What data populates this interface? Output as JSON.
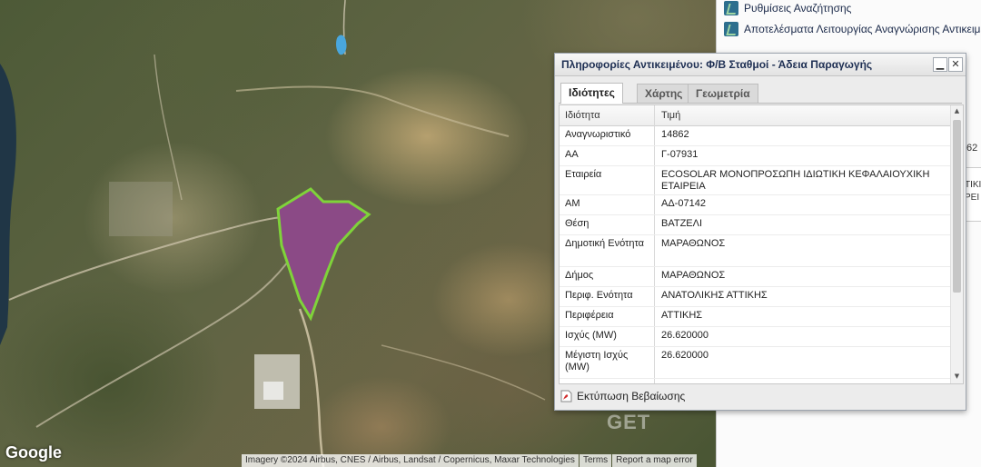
{
  "map": {
    "logo": "Google",
    "attribution": [
      "Imagery ©2024 Airbus, CNES / Airbus, Landsat / Copernicus, Maxar Technologies",
      "Terms",
      "Report a map error"
    ],
    "watermark": "GET",
    "parcel_color": "#8b4a86",
    "parcel_outline": "#7fd33a"
  },
  "side_panel": {
    "items": [
      {
        "label": "Ρυθμίσεις Αναζήτησης",
        "icon": "search-settings-icon"
      },
      {
        "label": "Αποτελέσματα Λειτουργίας Αναγνώρισης Αντικειμένων",
        "icon": "identify-results-icon"
      }
    ],
    "fragments": [
      "62",
      "ΤΙΚΙ",
      "ΡΕΙ"
    ]
  },
  "window": {
    "title": "Πληροφορίες Αντικειμένου: Φ/Β Σταθμοί - Άδεια Παραγωγής",
    "minimize": "▁",
    "close": "✕",
    "tabs": [
      "Ιδιότητες",
      "Χάρτης",
      "Γεωμετρία"
    ],
    "active_tab": "Ιδιότητες",
    "grid": {
      "headers": [
        "Ιδιότητα",
        "Τιμή"
      ],
      "rows": [
        {
          "key": "Αναγνωριστικό",
          "value": "14862"
        },
        {
          "key": "ΑΑ",
          "value": "Γ-07931"
        },
        {
          "key": "Εταιρεία",
          "value": "ECOSOLAR ΜΟΝΟΠΡΟΣΩΠΗ ΙΔΙΩΤΙΚΗ ΚΕΦΑΛΑΙΟΥΧΙΚΗ ΕΤΑΙΡΕΙΑ"
        },
        {
          "key": "ΑΜ",
          "value": "ΑΔ-07142"
        },
        {
          "key": "Θέση",
          "value": "ΒΑΤΖΕΛΙ"
        },
        {
          "key": "Δημοτική Ενότητα",
          "value": "ΜΑΡΑΘΩΝΟΣ"
        },
        {
          "key": "Δήμος",
          "value": "ΜΑΡΑΘΩΝΟΣ"
        },
        {
          "key": "Περιφ. Ενότητα",
          "value": "ΑΝΑΤΟΛΙΚΗΣ ΑΤΤΙΚΗΣ"
        },
        {
          "key": "Περιφέρεια",
          "value": "ΑΤΤΙΚΗΣ"
        },
        {
          "key": "Ισχύς (MW)",
          "value": "26.620000"
        },
        {
          "key": "Μέγιστη Ισχύς (MW)",
          "value": "26.620000"
        }
      ]
    },
    "footer": {
      "print_label": "Εκτύπωση Βεβαίωσης",
      "print_icon": "pdf-icon"
    }
  }
}
